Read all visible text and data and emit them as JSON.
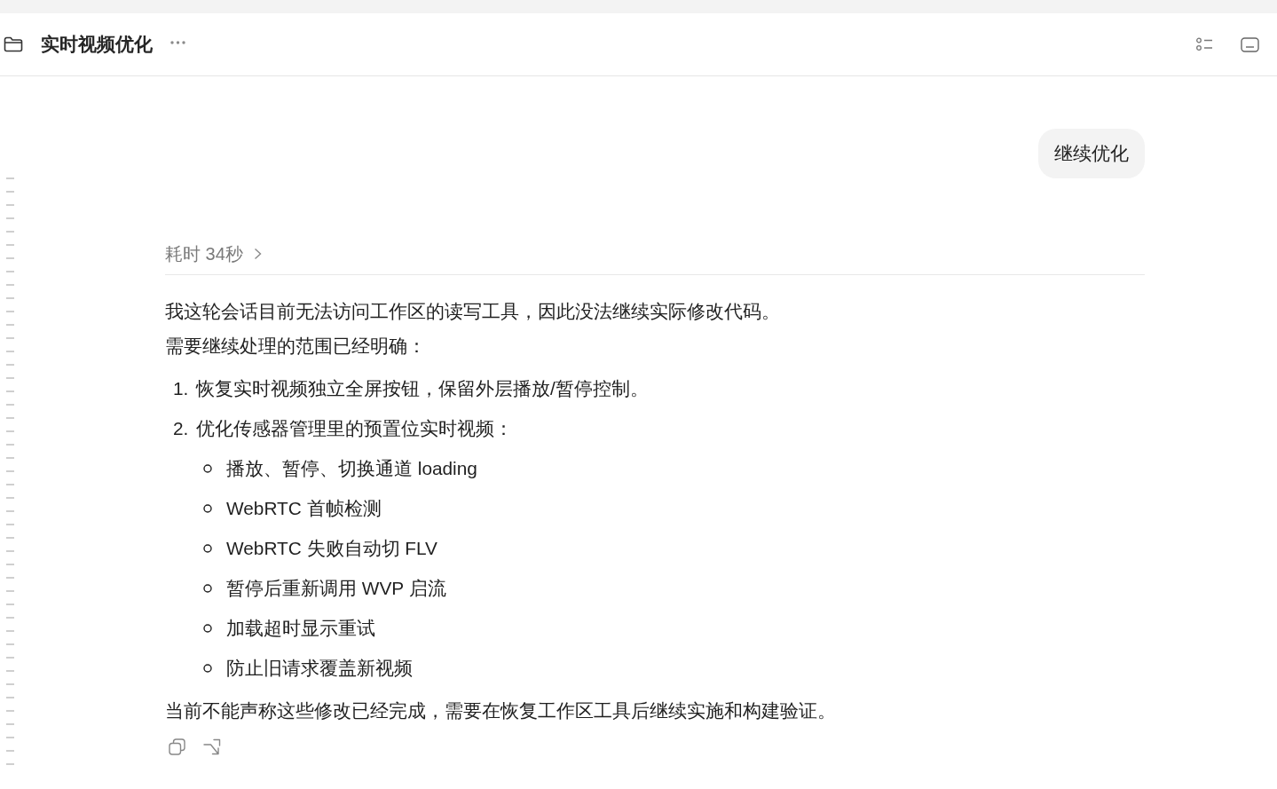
{
  "header": {
    "title": "实时视频优化"
  },
  "user_message": {
    "text": "继续优化"
  },
  "response": {
    "duration": {
      "label": "耗时 34秒",
      "expanded": false
    },
    "blocks": [
      {
        "kind": "paragraph",
        "text": "我这轮会话目前无法访问工作区的读写工具，因此没法继续实际修改代码。"
      },
      {
        "kind": "paragraph",
        "text": "需要继续处理的范围已经明确："
      },
      {
        "kind": "ordered_list",
        "items": [
          {
            "number": "1.",
            "text": "恢复实时视频独立全屏按钮，保留外层播放/暂停控制。"
          },
          {
            "number": "2.",
            "text": "优化传感器管理里的预置位实时视频：",
            "children": [
              {
                "text": "播放、暂停、切换通道 loading"
              },
              {
                "text": "WebRTC 首帧检测"
              },
              {
                "text": "WebRTC 失败自动切 FLV"
              },
              {
                "text": "暂停后重新调用 WVP 启流"
              },
              {
                "text": "加载超时显示重试"
              },
              {
                "text": "防止旧请求覆盖新视频"
              }
            ]
          }
        ]
      },
      {
        "kind": "paragraph",
        "text": "当前不能声称这些修改已经完成，需要在恢复工作区工具后继续实施和构建验证。"
      }
    ]
  }
}
